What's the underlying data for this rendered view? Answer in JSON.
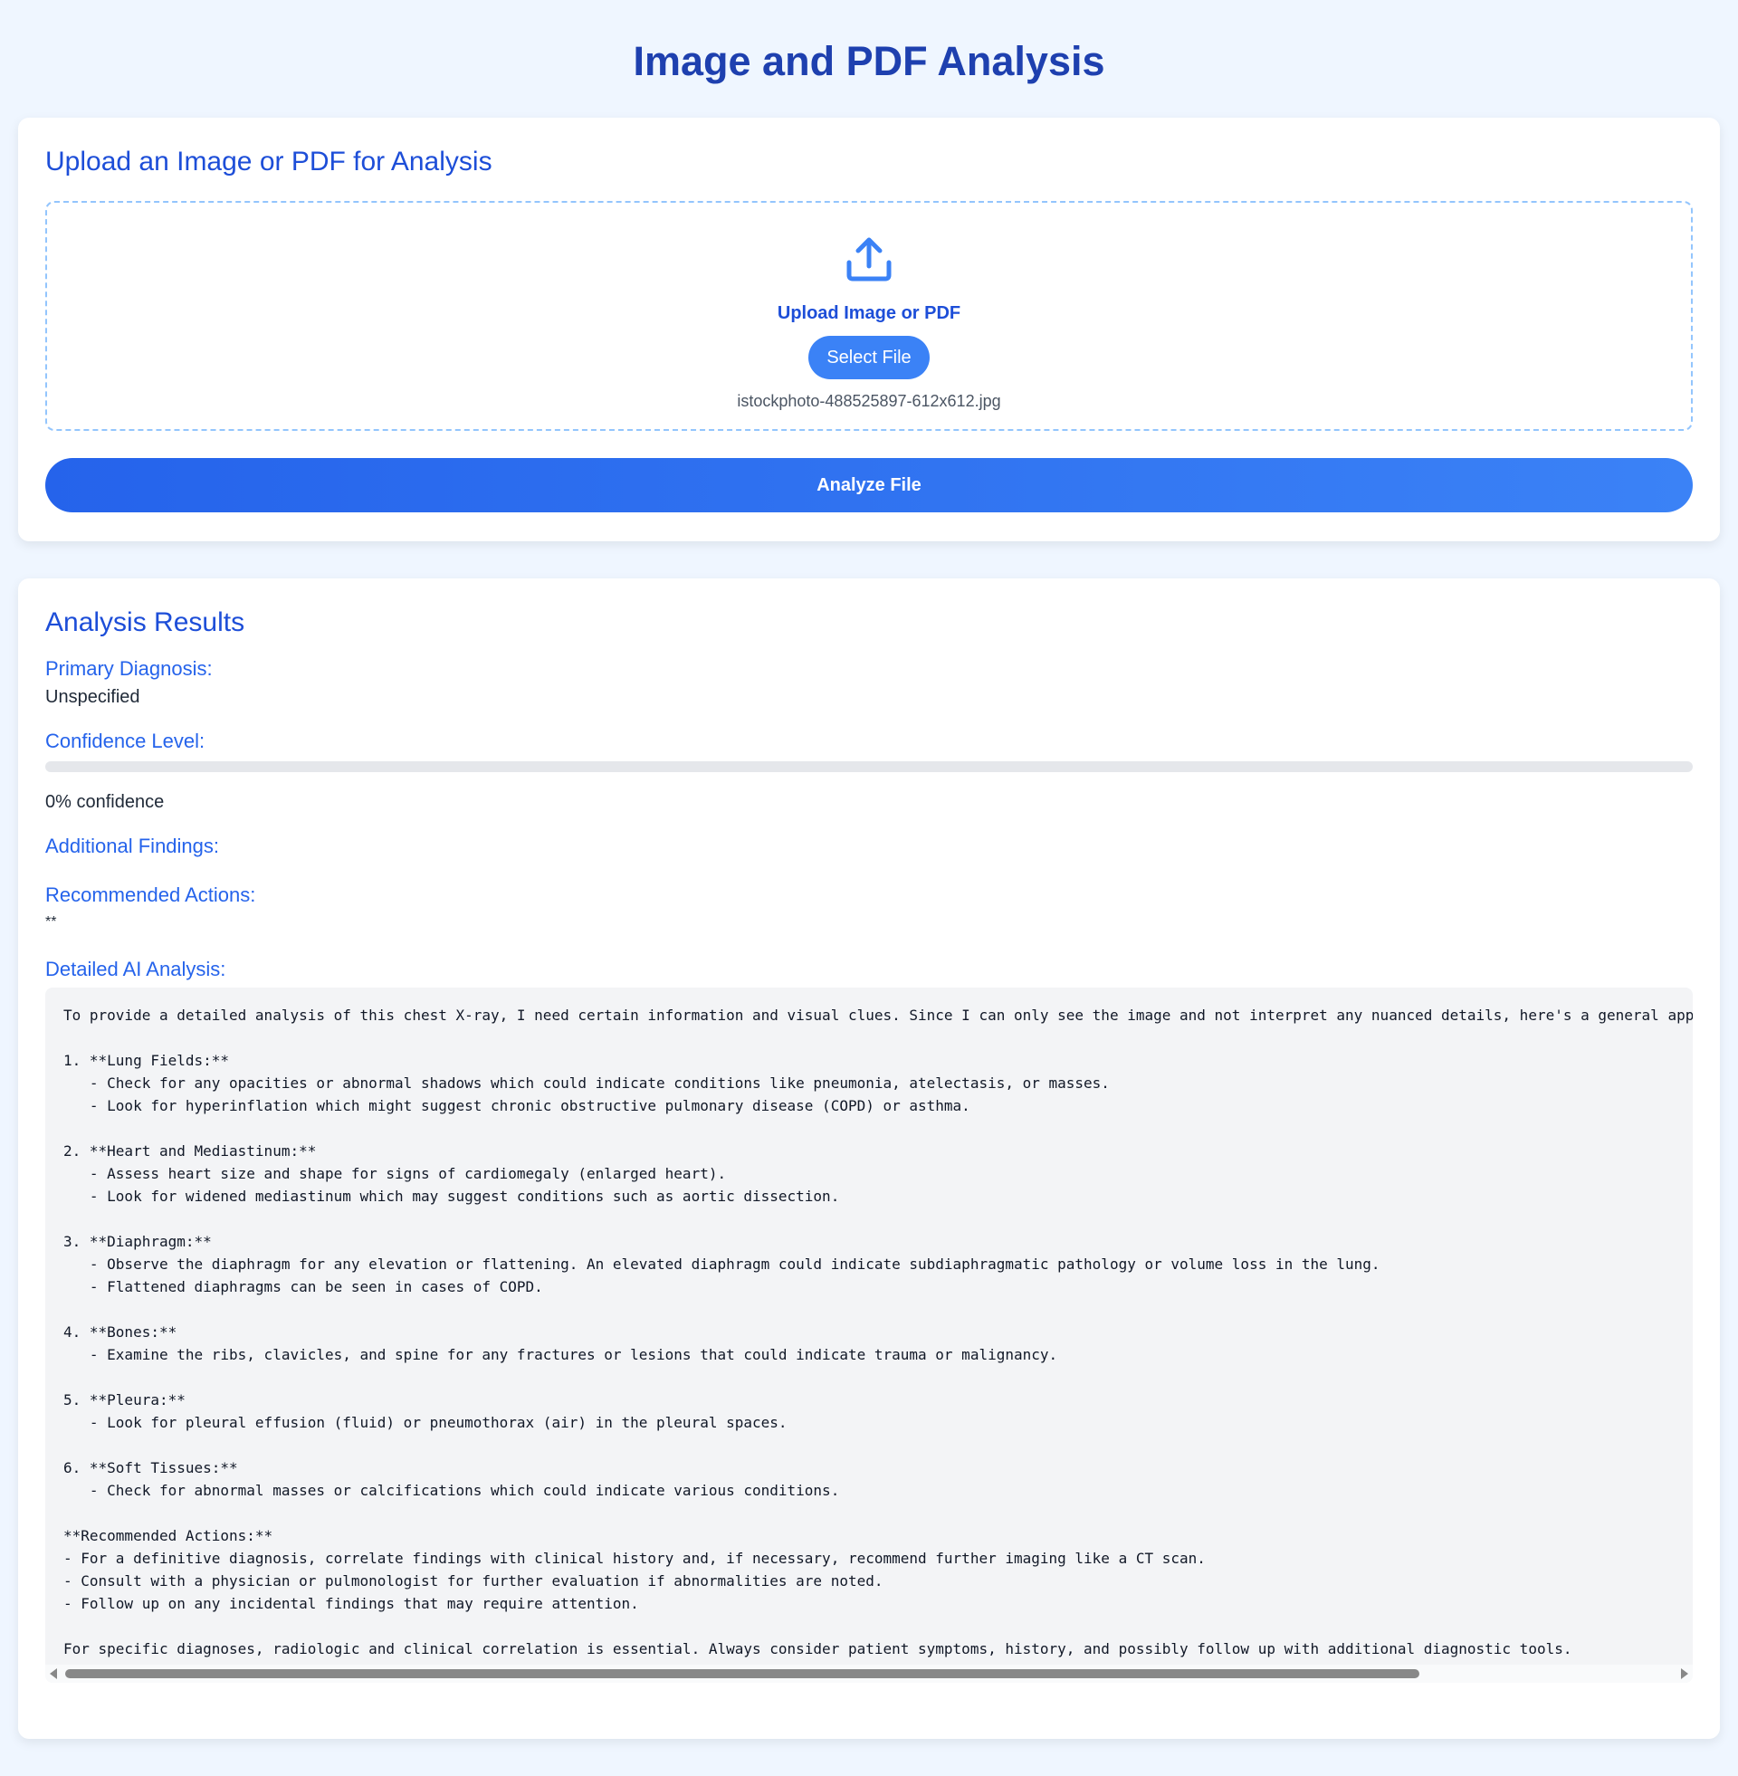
{
  "page": {
    "title": "Image and PDF Analysis"
  },
  "upload": {
    "heading": "Upload an Image or PDF for Analysis",
    "icon": "upload-icon",
    "dropzone_label": "Upload Image or PDF",
    "select_button_label": "Select File",
    "file_name": "istockphoto-488525897-612x612.jpg",
    "analyze_button_label": "Analyze File"
  },
  "results": {
    "heading": "Analysis Results",
    "primary_diagnosis_label": "Primary Diagnosis:",
    "primary_diagnosis_value": "Unspecified",
    "confidence_label": "Confidence Level:",
    "confidence_percent": 0,
    "confidence_text": "0% confidence",
    "additional_findings_label": "Additional Findings:",
    "recommended_actions_label": "Recommended Actions:",
    "recommended_actions_value": "**",
    "detailed_label": "Detailed AI Analysis:",
    "detailed_text": "To provide a detailed analysis of this chest X-ray, I need certain information and visual clues. Since I can only see the image and not interpret any nuanced details, here's a general app\n\n1. **Lung Fields:**\n   - Check for any opacities or abnormal shadows which could indicate conditions like pneumonia, atelectasis, or masses.\n   - Look for hyperinflation which might suggest chronic obstructive pulmonary disease (COPD) or asthma.\n\n2. **Heart and Mediastinum:**\n   - Assess heart size and shape for signs of cardiomegaly (enlarged heart).\n   - Look for widened mediastinum which may suggest conditions such as aortic dissection.\n\n3. **Diaphragm:**\n   - Observe the diaphragm for any elevation or flattening. An elevated diaphragm could indicate subdiaphragmatic pathology or volume loss in the lung.\n   - Flattened diaphragms can be seen in cases of COPD.\n\n4. **Bones:**\n   - Examine the ribs, clavicles, and spine for any fractures or lesions that could indicate trauma or malignancy.\n\n5. **Pleura:**\n   - Look for pleural effusion (fluid) or pneumothorax (air) in the pleural spaces.\n\n6. **Soft Tissues:**\n   - Check for abnormal masses or calcifications which could indicate various conditions.\n\n**Recommended Actions:**\n- For a definitive diagnosis, correlate findings with clinical history and, if necessary, recommend further imaging like a CT scan.\n- Consult with a physician or pulmonologist for further evaluation if abnormalities are noted.\n- Follow up on any incidental findings that may require attention.\n\nFor specific diagnoses, radiologic and clinical correlation is essential. Always consider patient symptoms, history, and possibly follow up with additional diagnostic tools."
  },
  "colors": {
    "accent": "#3b82f6",
    "heading": "#1e40af",
    "label": "#2563eb",
    "background": "#eff6ff"
  }
}
